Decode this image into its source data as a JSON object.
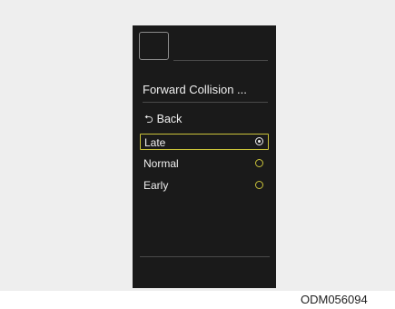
{
  "screen": {
    "title": "Forward Collision ...",
    "back_label": "Back",
    "back_icon": "return-arrow-icon",
    "options": [
      {
        "label": "Late",
        "selected": true
      },
      {
        "label": "Normal",
        "selected": false
      },
      {
        "label": "Early",
        "selected": false
      }
    ]
  },
  "caption": "ODM056094",
  "colors": {
    "screen_bg": "#1a1a1a",
    "highlight": "#c9c23a",
    "text": "#f0f0f0",
    "page_bg": "#eeeeee"
  }
}
